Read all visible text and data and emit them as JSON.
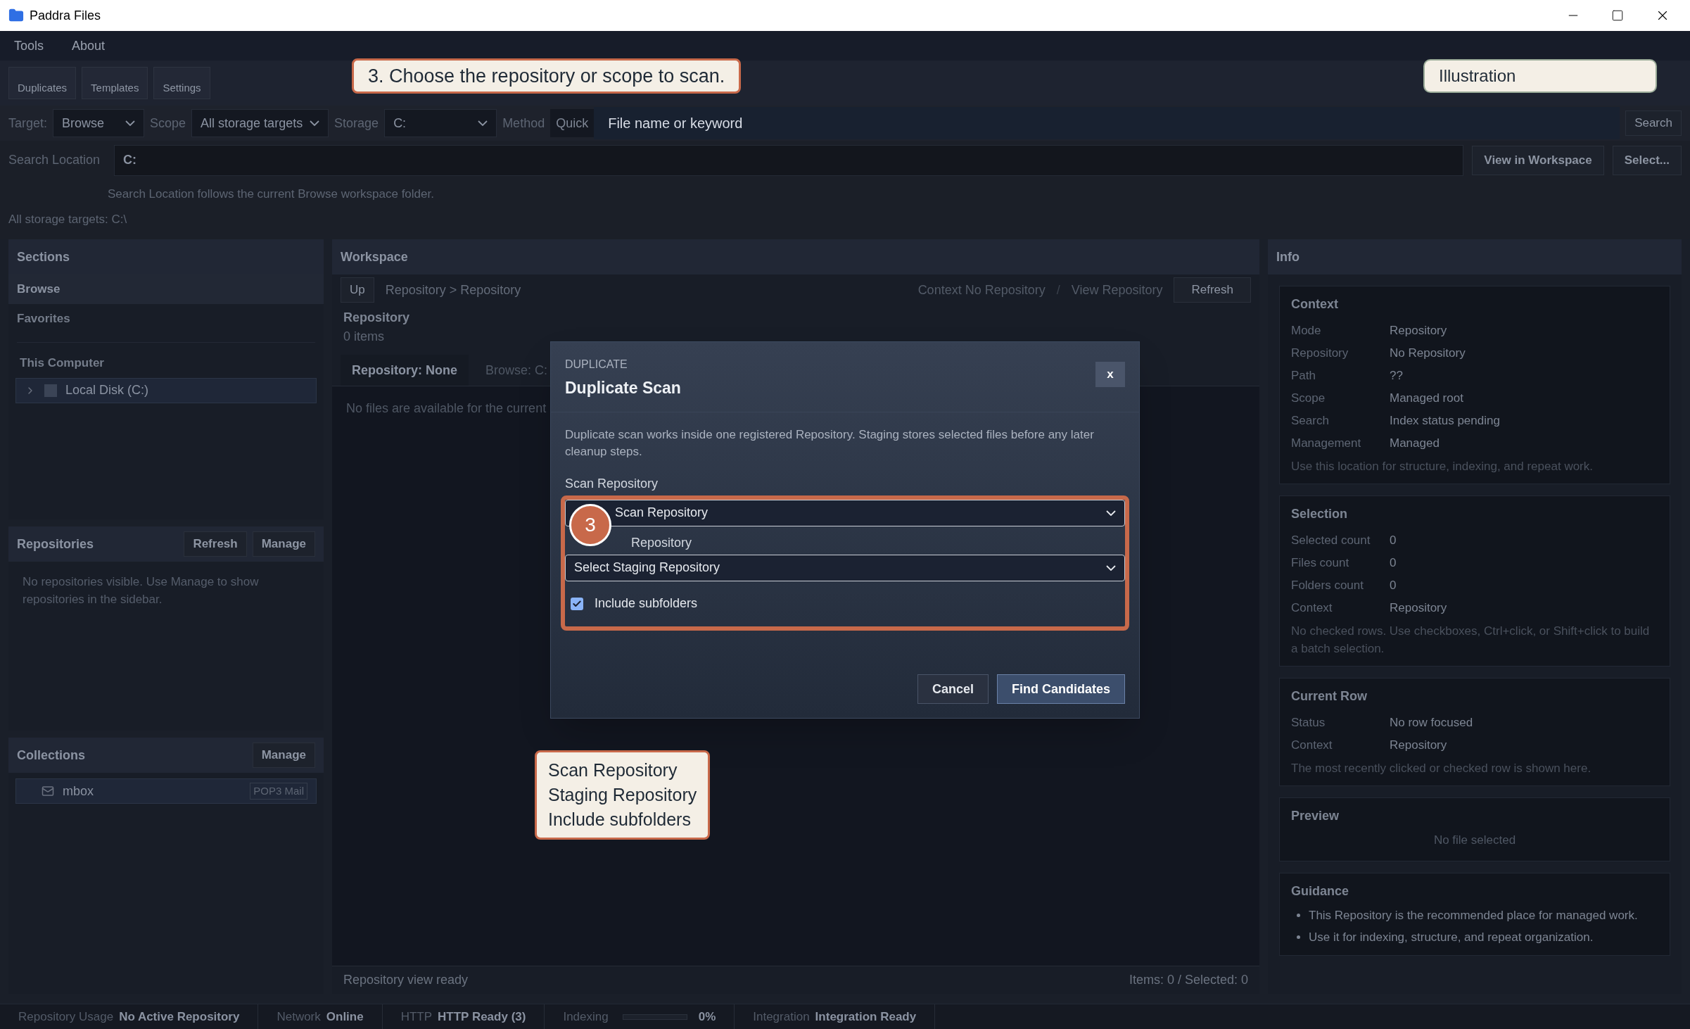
{
  "window": {
    "title": "Paddra Files"
  },
  "menu": [
    "Tools",
    "About"
  ],
  "toolbar": [
    {
      "label": "Duplicates"
    },
    {
      "label": "Templates"
    },
    {
      "label": "Settings"
    }
  ],
  "search_bar": {
    "target_label": "Target:",
    "target": "Browse",
    "scope_label": "Scope",
    "scope": "All storage targets",
    "storage_label": "Storage",
    "storage": "C:",
    "method_label": "Method",
    "method": "Quick",
    "query": {
      "placeholder": "File name or keyword"
    },
    "search_button": "Search"
  },
  "location": {
    "label": "Search Location",
    "value": "C:",
    "buttons": [
      "View in Workspace",
      "Select..."
    ],
    "hint": "Search Location follows the current Browse workspace folder.",
    "storage_targets": "All storage targets: C:\\"
  },
  "sidebar": {
    "sections": {
      "title": "Sections",
      "items": [
        {
          "label": "Browse",
          "selected": true
        },
        {
          "label": "Favorites",
          "selected": false
        }
      ],
      "group": "This Computer",
      "tree": [
        {
          "label": "Local Disk (C:)",
          "expanded": false
        }
      ]
    },
    "repositories": {
      "title": "Repositories",
      "buttons": [
        "Refresh",
        "Manage"
      ],
      "empty": "No repositories visible. Use Manage to show repositories in the sidebar."
    },
    "collections": {
      "title": "Collections",
      "buttons": [
        "Manage"
      ],
      "items": [
        {
          "label": "mbox",
          "tag": "POP3 Mail"
        }
      ]
    }
  },
  "workspace": {
    "title": "Workspace",
    "up": "Up",
    "breadcrumb": "Repository > Repository",
    "context": "Context No Repository",
    "separator": "/",
    "view": "View Repository",
    "refresh": "Refresh",
    "heading": "Repository",
    "count": "0 items",
    "tabs": [
      {
        "label": "Repository: None",
        "selected": true
      },
      {
        "label": "Browse: C:",
        "selected": false
      }
    ],
    "empty": "No files are available for the current",
    "status": "Repository view ready",
    "items": "Items: 0 / Selected: 0"
  },
  "dialog": {
    "eyebrow": "DUPLICATE",
    "title": "Duplicate Scan",
    "close": "x",
    "description": "Duplicate scan works inside one registered Repository. Staging stores selected files before any later cleanup steps.",
    "fields": [
      {
        "kind": "select",
        "label": "Scan Repository",
        "value": "Scan Repository"
      },
      {
        "kind": "select",
        "label": "Repository",
        "value": "Select Staging Repository"
      },
      {
        "kind": "checkbox",
        "label": "Include subfolders",
        "checked": true
      }
    ],
    "buttons": [
      {
        "label": "Cancel",
        "primary": false
      },
      {
        "label": "Find Candidates",
        "primary": true
      }
    ]
  },
  "annotations": {
    "step_callout": "3. Choose the repository or scope to scan.",
    "badge": "Illustration",
    "marker": "3",
    "list_callout": [
      "Scan Repository",
      "Staging Repository",
      "Include subfolders"
    ]
  },
  "info": {
    "title": "Info",
    "cards": [
      {
        "kind": "details",
        "title": "Context",
        "rows": [
          {
            "label": "Mode",
            "value": "Repository"
          },
          {
            "label": "Repository",
            "value": "No Repository"
          },
          {
            "label": "Path",
            "value": "??"
          },
          {
            "label": "Scope",
            "value": "Managed root"
          },
          {
            "label": "Search",
            "value": "Index status pending"
          },
          {
            "label": "Management",
            "value": "Managed"
          }
        ],
        "note": "Use this location for structure, indexing, and repeat work."
      },
      {
        "kind": "details",
        "title": "Selection",
        "rows": [
          {
            "label": "Selected count",
            "value": "0"
          },
          {
            "label": "Files count",
            "value": "0"
          },
          {
            "label": "Folders count",
            "value": "0"
          },
          {
            "label": "Context",
            "value": "Repository"
          }
        ],
        "note": "No checked rows. Use checkboxes, Ctrl+click, or Shift+click to build a batch selection."
      },
      {
        "kind": "details",
        "title": "Current Row",
        "rows": [
          {
            "label": "Status",
            "value": "No row focused"
          },
          {
            "label": "Context",
            "value": "Repository"
          }
        ],
        "note": "The most recently clicked or checked row is shown here."
      },
      {
        "kind": "empty",
        "title": "Preview",
        "text": "No file selected"
      },
      {
        "kind": "bullets",
        "title": "Guidance",
        "bullets": [
          "This Repository is the recommended place for managed work.",
          "Use it for indexing, structure, and repeat organization."
        ]
      }
    ]
  },
  "status_bar": [
    {
      "kind": "text",
      "label": "Repository Usage",
      "value": "No Active Repository"
    },
    {
      "kind": "text",
      "label": "Network",
      "value": "Online"
    },
    {
      "kind": "text",
      "label": "HTTP",
      "value": "HTTP Ready (3)"
    },
    {
      "kind": "progress",
      "label": "Indexing",
      "level": 0,
      "value": "0%"
    },
    {
      "kind": "text",
      "label": "Integration",
      "value": "Integration Ready"
    }
  ]
}
